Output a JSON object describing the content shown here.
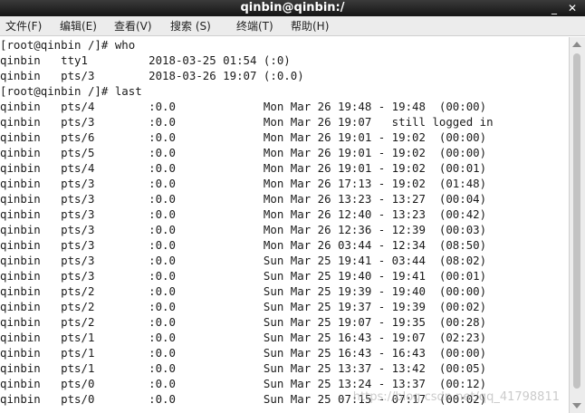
{
  "window": {
    "title": "qinbin@qinbin:/",
    "minimize_glyph": "_",
    "close_glyph": "✕"
  },
  "menu": {
    "items": [
      {
        "label": "文件(F)"
      },
      {
        "label": "编辑(E)"
      },
      {
        "label": "查看(V)"
      },
      {
        "label": "搜索 (S)"
      },
      {
        "label": "终端(T)"
      },
      {
        "label": "帮助(H)"
      }
    ]
  },
  "terminal": {
    "lines": [
      "[root@qinbin /]# who",
      "qinbin   tty1         2018-03-25 01:54 (:0)",
      "qinbin   pts/3        2018-03-26 19:07 (:0.0)",
      "[root@qinbin /]# last",
      "qinbin   pts/4        :0.0             Mon Mar 26 19:48 - 19:48  (00:00)",
      "qinbin   pts/3        :0.0             Mon Mar 26 19:07   still logged in",
      "qinbin   pts/6        :0.0             Mon Mar 26 19:01 - 19:02  (00:00)",
      "qinbin   pts/5        :0.0             Mon Mar 26 19:01 - 19:02  (00:00)",
      "qinbin   pts/4        :0.0             Mon Mar 26 19:01 - 19:02  (00:01)",
      "qinbin   pts/3        :0.0             Mon Mar 26 17:13 - 19:02  (01:48)",
      "qinbin   pts/3        :0.0             Mon Mar 26 13:23 - 13:27  (00:04)",
      "qinbin   pts/3        :0.0             Mon Mar 26 12:40 - 13:23  (00:42)",
      "qinbin   pts/3        :0.0             Mon Mar 26 12:36 - 12:39  (00:03)",
      "qinbin   pts/3        :0.0             Mon Mar 26 03:44 - 12:34  (08:50)",
      "qinbin   pts/3        :0.0             Sun Mar 25 19:41 - 03:44  (08:02)",
      "qinbin   pts/3        :0.0             Sun Mar 25 19:40 - 19:41  (00:01)",
      "qinbin   pts/2        :0.0             Sun Mar 25 19:39 - 19:40  (00:00)",
      "qinbin   pts/2        :0.0             Sun Mar 25 19:37 - 19:39  (00:02)",
      "qinbin   pts/2        :0.0             Sun Mar 25 19:07 - 19:35  (00:28)",
      "qinbin   pts/1        :0.0             Sun Mar 25 16:43 - 19:07  (02:23)",
      "qinbin   pts/1        :0.0             Sun Mar 25 16:43 - 16:43  (00:00)",
      "qinbin   pts/1        :0.0             Sun Mar 25 13:37 - 13:42  (00:05)",
      "qinbin   pts/0        :0.0             Sun Mar 25 13:24 - 13:37  (00:12)",
      "qinbin   pts/0        :0.0             Sun Mar 25 07:15 - 07:17  (00:02)"
    ]
  },
  "watermark": {
    "text": "https://blog.csdn.net/qq_41798811"
  },
  "colors": {
    "titlebar": "#1e1e1e",
    "menubar": "#ececec",
    "terminal_bg": "#ffffff",
    "terminal_fg": "#1a1a1a"
  },
  "icons": {
    "minimize": "minimize-icon",
    "close": "close-icon",
    "scroll_up": "scroll-up-arrow-icon",
    "scroll_down": "scroll-down-arrow-icon"
  }
}
